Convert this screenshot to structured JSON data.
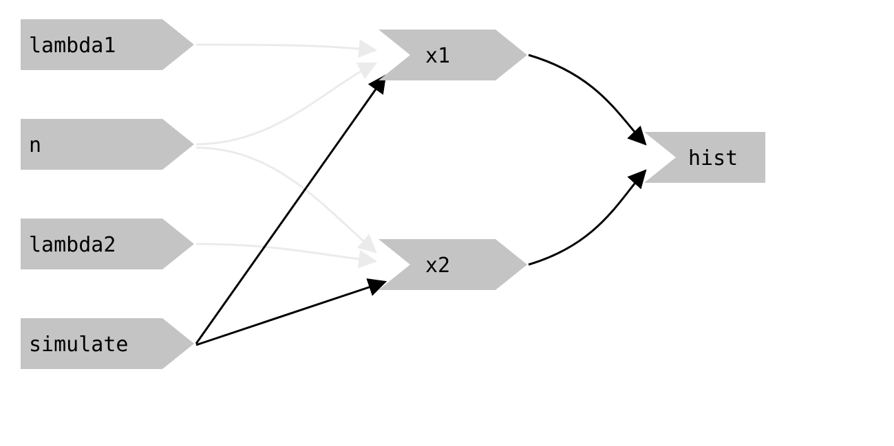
{
  "diagram": {
    "nodes": {
      "lambda1": {
        "label": "lambda1"
      },
      "n": {
        "label": "n"
      },
      "lambda2": {
        "label": "lambda2"
      },
      "simulate": {
        "label": "simulate"
      },
      "x1": {
        "label": "x1"
      },
      "x2": {
        "label": "x2"
      },
      "hist": {
        "label": "hist"
      }
    },
    "edges": [
      {
        "from": "lambda1",
        "to": "x1",
        "faded": true
      },
      {
        "from": "n",
        "to": "x1",
        "faded": true
      },
      {
        "from": "n",
        "to": "x2",
        "faded": true
      },
      {
        "from": "lambda2",
        "to": "x2",
        "faded": true
      },
      {
        "from": "simulate",
        "to": "x1",
        "faded": false
      },
      {
        "from": "simulate",
        "to": "x2",
        "faded": false
      },
      {
        "from": "x1",
        "to": "hist",
        "faded": false
      },
      {
        "from": "x2",
        "to": "hist",
        "faded": false
      }
    ],
    "colors": {
      "node_fill": "#c4c4c4",
      "edge_dark": "#000000",
      "edge_light": "#ebebeb"
    }
  }
}
